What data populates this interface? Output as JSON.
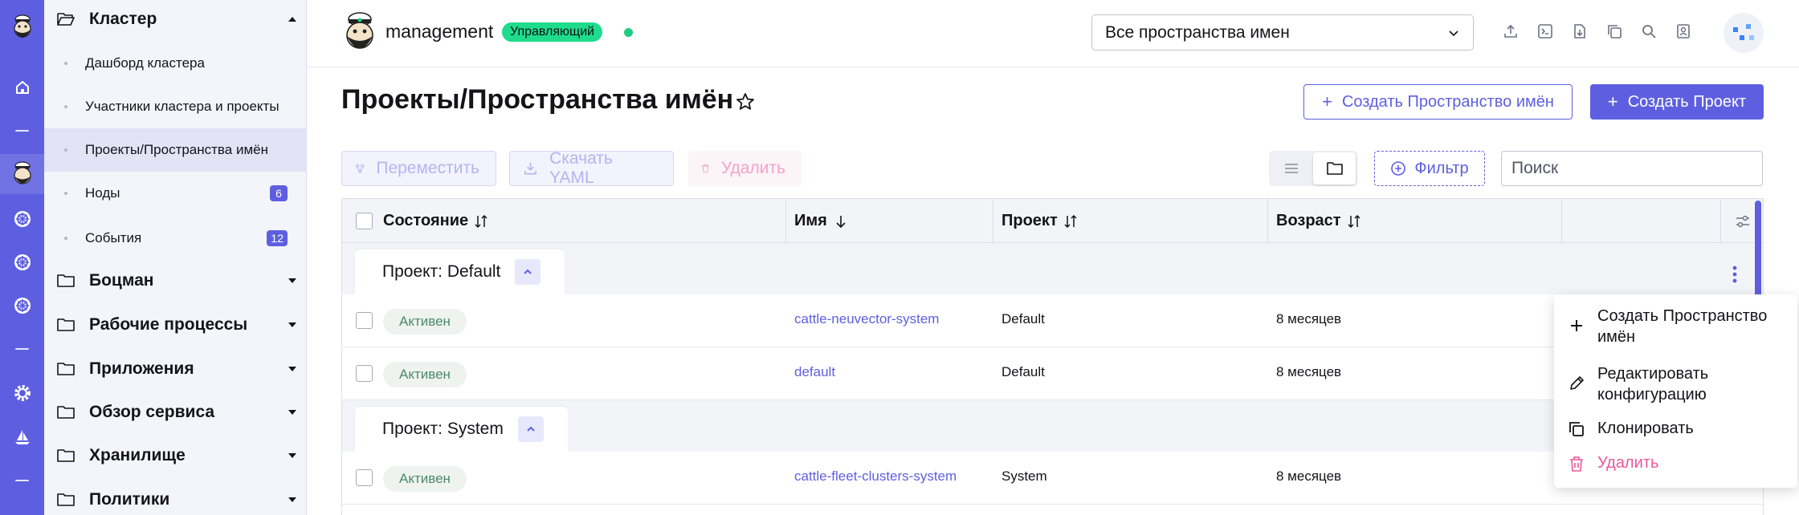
{
  "colors": {
    "accent": "#5e5fe0",
    "success": "#1edc8c",
    "danger": "#e8589b",
    "state_text": "#4c8a6d"
  },
  "sidebar": {
    "groups": [
      {
        "label": "Кластер",
        "expanded": true
      },
      {
        "label": "Боцман"
      },
      {
        "label": "Рабочие процессы"
      },
      {
        "label": "Приложения"
      },
      {
        "label": "Обзор сервиса"
      },
      {
        "label": "Хранилище"
      },
      {
        "label": "Политики"
      }
    ],
    "cluster_items": [
      {
        "label": "Дашборд кластера"
      },
      {
        "label": "Участники кластера и проекты"
      },
      {
        "label": "Проекты/Пространства имён",
        "active": true
      },
      {
        "label": "Ноды",
        "badge": "6"
      },
      {
        "label": "События",
        "badge": "12"
      }
    ]
  },
  "header": {
    "cluster_name": "management",
    "cluster_badge": "Управляющий",
    "namespace_filter": "Все пространства имен",
    "icons": [
      "upload-icon",
      "terminal-icon",
      "download-icon",
      "copy-icon",
      "search-icon",
      "account-icon"
    ]
  },
  "page": {
    "title": "Проекты/Пространства имён",
    "create_namespace": "Создать Пространство имён",
    "create_project": "Создать Проект"
  },
  "bulk": {
    "move": "Переместить",
    "download_yaml": "Скачать YAML",
    "delete": "Удалить"
  },
  "toolbar": {
    "filter": "Фильтр",
    "search_placeholder": "Поиск"
  },
  "table": {
    "columns": [
      "Состояние",
      "Имя",
      "Проект",
      "Возраст"
    ],
    "groups": [
      {
        "label": "Проект: Default",
        "rows": [
          {
            "state": "Активен",
            "name": "cattle-neuvector-system",
            "project": "Default",
            "age": "8 месяцев"
          },
          {
            "state": "Активен",
            "name": "default",
            "project": "Default",
            "age": "8 месяцев"
          }
        ]
      },
      {
        "label": "Проект: System",
        "rows": [
          {
            "state": "Активен",
            "name": "cattle-fleet-clusters-system",
            "project": "System",
            "age": "8 месяцев"
          }
        ]
      }
    ]
  },
  "context_menu": {
    "items": [
      {
        "label": "Создать Пространство имён",
        "icon": "plus-icon"
      },
      {
        "label": "Редактировать конфигурацию",
        "icon": "pencil-icon"
      },
      {
        "label": "Клонировать",
        "icon": "copy-icon"
      },
      {
        "label": "Удалить",
        "icon": "trash-icon"
      }
    ]
  }
}
